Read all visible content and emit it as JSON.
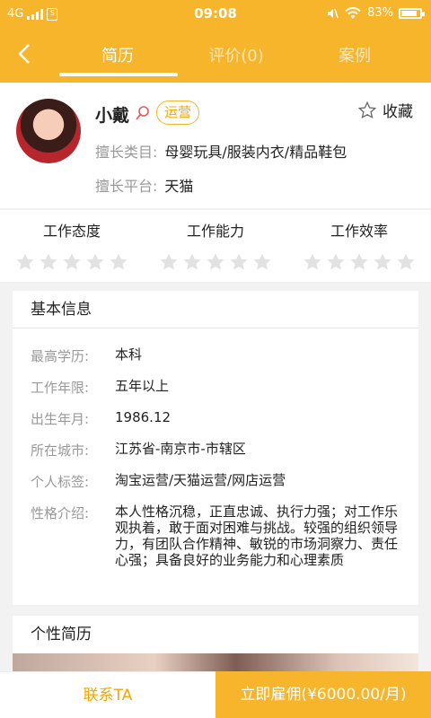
{
  "status": {
    "network": "4G",
    "time": "09:08",
    "battery": "83%",
    "battery_level": 0.83
  },
  "tabs": [
    {
      "label": "简历",
      "active": true
    },
    {
      "label": "评价(0)",
      "active": false
    },
    {
      "label": "案例",
      "active": false
    }
  ],
  "profile": {
    "name": "小戴",
    "role_badge": "运营",
    "favorite_label": "收藏",
    "specialty_label": "擅长类目:",
    "specialty_value": "母婴玩具/服装内衣/精品鞋包",
    "platform_label": "擅长平台:",
    "platform_value": "天猫"
  },
  "ratings": [
    {
      "title": "工作态度",
      "stars": 0,
      "max": 5
    },
    {
      "title": "工作能力",
      "stars": 0,
      "max": 5
    },
    {
      "title": "工作效率",
      "stars": 0,
      "max": 5
    }
  ],
  "basic_info": {
    "title": "基本信息",
    "rows": [
      {
        "label": "最高学历:",
        "value": "本科"
      },
      {
        "label": "工作年限:",
        "value": "五年以上"
      },
      {
        "label": "出生年月:",
        "value": "1986.12"
      },
      {
        "label": "所在城市:",
        "value": "江苏省-南京市-市辖区"
      },
      {
        "label": "个人标签:",
        "value": "淘宝运营/天猫运营/网店运营"
      },
      {
        "label": "性格介绍:",
        "value": "本人性格沉稳，正直忠诚、执行力强；对工作乐观执着，敢于面对困难与挑战。较强的组织领导力，有团队合作精神、敏锐的市场洞察力、责任心强；具备良好的业务能力和心理素质"
      }
    ]
  },
  "personal_resume": {
    "title": "个性简历"
  },
  "bottom": {
    "contact_label": "联系TA",
    "hire_label": "立即雇佣(¥6000.00/月)"
  },
  "colors": {
    "accent": "#f7b52b",
    "accent_text": "#f7a500",
    "star_empty": "#e2e2e2"
  }
}
